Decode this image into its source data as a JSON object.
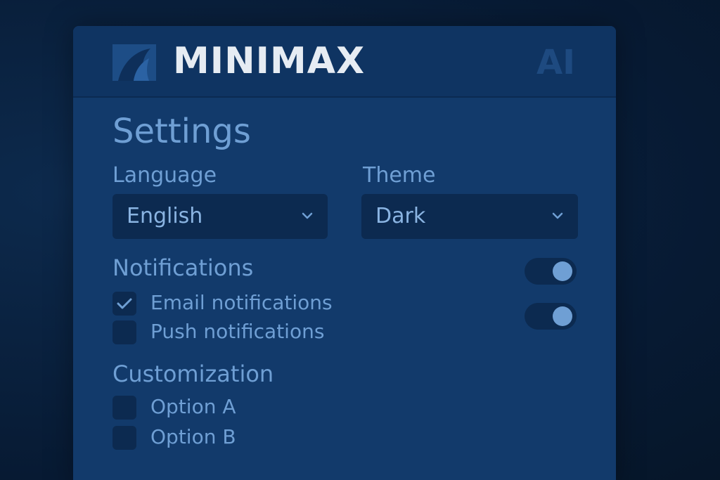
{
  "header": {
    "brand": "MINIMAX",
    "brand_suffix": "AI",
    "logo_icon": "shark-fin-logo"
  },
  "settings": {
    "title": "Settings",
    "language": {
      "label": "Language",
      "value": "English"
    },
    "theme": {
      "label": "Theme",
      "value": "Dark"
    }
  },
  "notifications": {
    "heading": "Notifications",
    "items": [
      {
        "label": "Email notifications",
        "checked": true,
        "toggle_on": true
      },
      {
        "label": "Push notifications",
        "checked": false,
        "toggle_on": true
      }
    ]
  },
  "customization": {
    "heading": "Customization",
    "options": [
      {
        "label": "Option A",
        "checked": false
      },
      {
        "label": "Option B",
        "checked": false
      }
    ]
  },
  "colors": {
    "background": "#071a33",
    "panel": "#123a6b",
    "header": "#0f3462",
    "control": "#0c2a50",
    "accent_text": "#6f9fd4",
    "brand_text": "#e6ecf3"
  }
}
